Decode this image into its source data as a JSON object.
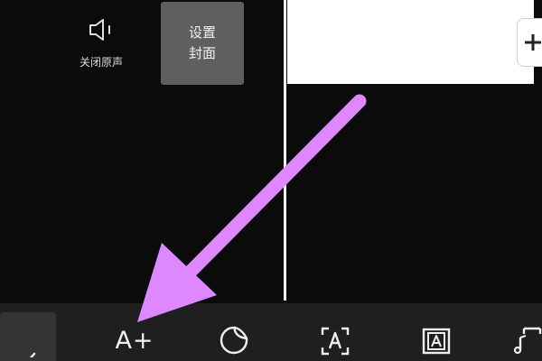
{
  "top_controls": {
    "mute_label": "关闭原声",
    "cover_line1": "设置",
    "cover_line2": "封面"
  },
  "toolbar": {
    "add_text_label": "A+",
    "items": [
      {
        "icon": "back-chevron-icon"
      },
      {
        "icon": "add-text-icon"
      },
      {
        "icon": "sticker-icon"
      },
      {
        "icon": "text-recognition-icon"
      },
      {
        "icon": "text-template-icon"
      },
      {
        "icon": "music-text-icon"
      }
    ]
  },
  "annotation": {
    "arrow_color": "#dd88ff"
  }
}
